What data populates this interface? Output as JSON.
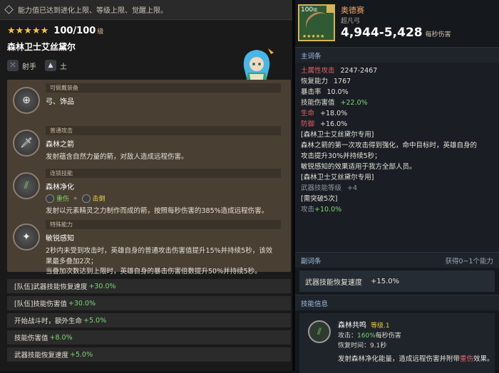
{
  "notice": "能力值已达到进化上限、等级上限、觉醒上限。",
  "hero": {
    "stars": "★★★★★",
    "level": "100/100",
    "level_unit": "级",
    "name": "森林卫士艾丝黛尔",
    "class_label": "射手",
    "element_label": "土"
  },
  "skills": [
    {
      "tag": "可佩戴装备",
      "title": "弓、饰品",
      "desc": ""
    },
    {
      "tag": "普通攻击",
      "title": "森林之箭",
      "desc": "发射蕴含自然力量的箭，对敌人造成远程伤害。"
    },
    {
      "tag": "连锁技能",
      "title": "森林净化",
      "chain_from": "重伤",
      "chain_to": "击倒",
      "desc": "发射以元素精灵之力制作而成的箭，按照每秒伤害的385%造成远程伤害。"
    },
    {
      "tag": "特殊能力",
      "title": "敏锐感知",
      "desc_lines": [
        "2秒内未受到攻击时，英雄自身的普通攻击伤害值提升15%并持续5秒，该效",
        "果最多叠加2次；",
        "当叠加次数达到上限时，英雄自身的暴击伤害倍数提升50%并持续5秒。"
      ]
    }
  ],
  "team_rows": [
    {
      "label": "[队伍]武器技能恢复速度",
      "value": "+30.0%"
    },
    {
      "label": "[队伍]技能伤害值",
      "value": "+30.0%"
    },
    {
      "label": "开始战斗时，额外生命",
      "value": "+5.0%"
    },
    {
      "label": "技能伤害值",
      "value": "+8.0%"
    },
    {
      "label": "武器技能恢复速度",
      "value": "+5.0%"
    }
  ],
  "weapon": {
    "level": "100",
    "level_unit": "级",
    "stars": "★★★★★",
    "name": "奥德赛",
    "rarity": "超凡弓",
    "damage": "4,944-5,428",
    "damage_unit": "每秒伤害"
  },
  "main_opts_header": "主词条",
  "main_opts": {
    "earth_atk_label": "土属性攻击",
    "earth_atk_value": "2247-2467",
    "recovery_label": "恢复能力",
    "recovery_value": "1767",
    "crit_label": "暴击率",
    "crit_value": "10.0%",
    "skill_dmg_label": "技能伤害值",
    "skill_dmg_value": "+22.0%",
    "hp_label": "生命",
    "hp_value": "+18.0%",
    "def_label": "防御",
    "def_value": "+16.0%",
    "exclusive1": "[森林卫士艾丝黛尔专用]",
    "exclusive1_desc_1": "森林之箭的第一次攻击得到强化，命中目标时，英雄自身的",
    "exclusive1_desc_2": "攻击提升30%并持续5秒；",
    "exclusive1_desc_3": "敏锐感知的效果适用于我方全部人员。",
    "exclusive2": "[森林卫士艾丝黛尔专用]",
    "exclusive2_desc": "武器技能等级",
    "exclusive2_value": "+4",
    "limit_break": "[需突破5次]",
    "atk_label": "攻击",
    "atk_value": "+10.0%"
  },
  "sub_opts_header": "副词条",
  "sub_opts_right": "获得0~1个能力",
  "sub_opt": {
    "label": "武器技能恢复速度",
    "value": "+15.0%"
  },
  "skill_info_header": "技能信息",
  "skill_info": {
    "name": "森林共鸣",
    "level": "等级.1",
    "attack_label": "攻击：",
    "attack_value": "160%",
    "attack_unit": "每秒伤害",
    "cooldown_label": "恢复时间：",
    "cooldown_value": "9.1秒",
    "desc_pre": "发射森林净化能量，造成远程伤害并附带",
    "desc_red": "重伤",
    "desc_post": "效果。"
  },
  "colors": {
    "accent_green": "#7dd672",
    "accent_red": "#e46262",
    "star_gold": "#f4c542",
    "header_blue": "#9fc0e6"
  }
}
